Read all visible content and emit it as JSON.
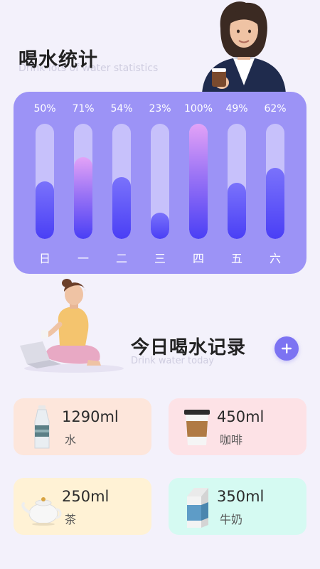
{
  "header": {
    "title": "喝水统计",
    "subtitle": "Drink lots of water statistics"
  },
  "weekly_stats": [
    {
      "day": "日",
      "percent_label": "50%",
      "percent": 50
    },
    {
      "day": "一",
      "percent_label": "71%",
      "percent": 71
    },
    {
      "day": "二",
      "percent_label": "54%",
      "percent": 54
    },
    {
      "day": "三",
      "percent_label": "23%",
      "percent": 23
    },
    {
      "day": "四",
      "percent_label": "100%",
      "percent": 100
    },
    {
      "day": "五",
      "percent_label": "49%",
      "percent": 49
    },
    {
      "day": "六",
      "percent_label": "62%",
      "percent": 62
    }
  ],
  "today": {
    "title": "今日喝水记录",
    "subtitle": "Drink water today",
    "add_icon": "plus-circle-icon"
  },
  "records": [
    {
      "amount": "1290ml",
      "label": "水",
      "icon": "water-bottle-icon"
    },
    {
      "amount": "450ml",
      "label": "咖啡",
      "icon": "coffee-cup-icon"
    },
    {
      "amount": "250ml",
      "label": "茶",
      "icon": "teapot-icon"
    },
    {
      "amount": "350ml",
      "label": "牛奶",
      "icon": "milk-carton-icon"
    }
  ],
  "colors": {
    "card": "#9c93f6",
    "bar_fill": "#4a3ff5",
    "bar_highlight": "#e3a2f7",
    "accent": "#7c73f2"
  }
}
